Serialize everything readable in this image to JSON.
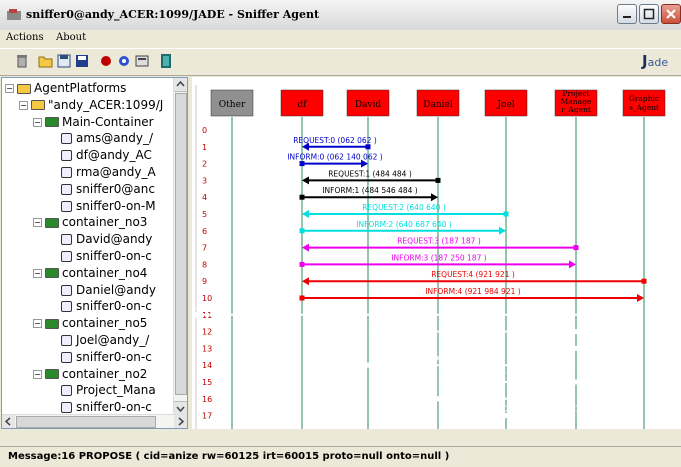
{
  "window": {
    "title": "sniffer0@andy_ACER:1099/JADE - Sniffer Agent"
  },
  "menu": {
    "actions": "Actions",
    "about": "About"
  },
  "toolbar": {
    "logo_text": "ade"
  },
  "tree": [
    {
      "label": "AgentPlatforms",
      "type": "folder"
    },
    {
      "label": "\"andy_ACER:1099/J",
      "type": "folder"
    },
    {
      "label": "Main-Container",
      "type": "container"
    },
    {
      "label": "ams@andy_/",
      "type": "agent"
    },
    {
      "label": "df@andy_AC",
      "type": "agent"
    },
    {
      "label": "rma@andy_A",
      "type": "agent"
    },
    {
      "label": "sniffer0@anc",
      "type": "agent"
    },
    {
      "label": "sniffer0-on-M",
      "type": "agent"
    },
    {
      "label": "container_no3",
      "type": "container"
    },
    {
      "label": "David@andy",
      "type": "agent"
    },
    {
      "label": "sniffer0-on-c",
      "type": "agent"
    },
    {
      "label": "container_no4",
      "type": "container"
    },
    {
      "label": "Daniel@andy",
      "type": "agent"
    },
    {
      "label": "sniffer0-on-c",
      "type": "agent"
    },
    {
      "label": "container_no5",
      "type": "container"
    },
    {
      "label": "Joel@andy_/",
      "type": "agent"
    },
    {
      "label": "sniffer0-on-c",
      "type": "agent"
    },
    {
      "label": "container_no2",
      "type": "container"
    },
    {
      "label": "Project_Mana",
      "type": "agent"
    },
    {
      "label": "sniffer0-on-c",
      "type": "agent"
    }
  ],
  "agents": [
    {
      "name": "Other",
      "color": "#909090"
    },
    {
      "name": "df",
      "color": "#ff0000"
    },
    {
      "name": "David",
      "color": "#ff0000"
    },
    {
      "name": "Daniel",
      "color": "#ff0000"
    },
    {
      "name": "Joel",
      "color": "#ff0000"
    },
    {
      "name": "Project_Manager_Agent",
      "label_lines": [
        "Project",
        "Manage",
        "r_Agent"
      ],
      "color": "#ff0000"
    },
    {
      "name": "Graphics_Agent",
      "label_lines": [
        "Graphic",
        "s_Agent"
      ],
      "color": "#ff0000"
    }
  ],
  "row_numbers": [
    "0",
    "1",
    "2",
    "3",
    "4",
    "5",
    "6",
    "7",
    "8",
    "9",
    "10",
    "11",
    "12",
    "13",
    "14",
    "15",
    "16",
    "17"
  ],
  "messages": [
    {
      "row": 1,
      "from": 2,
      "to": 1,
      "label": "REQUEST:0 (062  062   )",
      "color": "#0000cc"
    },
    {
      "row": 2,
      "from": 1,
      "to": 2,
      "label": "INFORM:0 (062  140  062 )",
      "color": "#0000cc"
    },
    {
      "row": 3,
      "from": 3,
      "to": 1,
      "label": "REQUEST:1 (484  484  )",
      "color": "#000000"
    },
    {
      "row": 4,
      "from": 1,
      "to": 3,
      "label": "INFORM:1 (484  546  484 )",
      "color": "#000000"
    },
    {
      "row": 5,
      "from": 4,
      "to": 1,
      "label": "REQUEST:2 (640  640   )",
      "color": "#00e0e0"
    },
    {
      "row": 6,
      "from": 1,
      "to": 4,
      "label": "INFORM:2 (640  687  640 )",
      "color": "#00e0e0"
    },
    {
      "row": 7,
      "from": 5,
      "to": 1,
      "label": "REQUEST:3 (187  187   )",
      "color": "#ee00ee"
    },
    {
      "row": 8,
      "from": 1,
      "to": 5,
      "label": "INFORM:3 (187  250  187 )",
      "color": "#ee00ee"
    },
    {
      "row": 9,
      "from": 6,
      "to": 1,
      "label": "REQUEST:4 (921  921   )",
      "color": "#ee0000"
    },
    {
      "row": 10,
      "from": 1,
      "to": 6,
      "label": "INFORM:4 (921  984  921 )",
      "color": "#ee0000"
    },
    {
      "row": 11,
      "from": 7,
      "to": 5,
      "label": "REQUEST:5 (ize  062",
      "color": "#ffffff"
    },
    {
      "row": 12,
      "from": 5,
      "to": 2,
      "label": "CFP:5 (ize  015",
      "color": "#ffffff"
    },
    {
      "row": 13,
      "from": 5,
      "to": 4,
      "label": "CFP:5 (ize  015   )",
      "color": "#ffffff"
    },
    {
      "row": 14,
      "from": 2,
      "to": 5,
      "label": "PROPOSE:5 (ize  062  015 )",
      "color": "#ffffff"
    },
    {
      "row": 15,
      "from": 5,
      "to": 3,
      "label": "CFP:5 (ize  015",
      "color": "#ffffff"
    },
    {
      "row": 16,
      "from": 3,
      "to": 5,
      "label": "PROPOSE:5 (ize  109  015 )",
      "color": "#ffffff"
    },
    {
      "row": 17,
      "from": 4,
      "to": 5,
      "label": "PROPOSE:5 (ize  125  015 )",
      "color": "#ffffff"
    }
  ],
  "status": {
    "message": "Message:16 PROPOSE ( cid=anize rw=60125 irt=60015 proto=null onto=null )"
  }
}
